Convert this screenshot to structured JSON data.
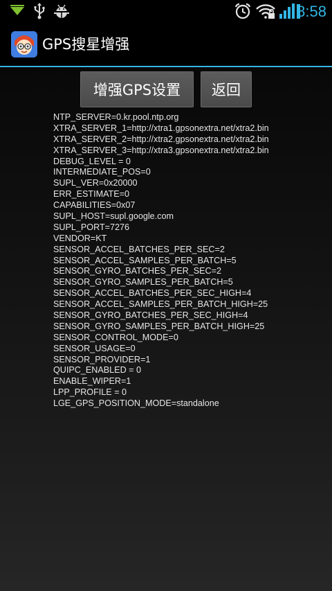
{
  "status_bar": {
    "time": "8:58",
    "icons": [
      "download-arrow-icon",
      "usb-icon",
      "android-bug-icon",
      "alarm-clock-icon",
      "wifi-locked-icon",
      "signal-bars-icon",
      "battery-icon"
    ],
    "time_color": "#33b5e5"
  },
  "title_bar": {
    "title": "GPS搜星增强",
    "icon": "app-icon",
    "divider_color": "#33b5e5"
  },
  "buttons": {
    "enhance_label": "增强GPS设置",
    "back_label": "返回"
  },
  "config_lines": [
    "NTP_SERVER=0.kr.pool.ntp.org",
    "XTRA_SERVER_1=http://xtra1.gpsonextra.net/xtra2.bin",
    "XTRA_SERVER_2=http://xtra2.gpsonextra.net/xtra2.bin",
    "XTRA_SERVER_3=http://xtra3.gpsonextra.net/xtra2.bin",
    "DEBUG_LEVEL = 0",
    "INTERMEDIATE_POS=0",
    "SUPL_VER=0x20000",
    "ERR_ESTIMATE=0",
    "CAPABILITIES=0x07",
    "SUPL_HOST=supl.google.com",
    "SUPL_PORT=7276",
    "VENDOR=KT",
    "SENSOR_ACCEL_BATCHES_PER_SEC=2",
    "SENSOR_ACCEL_SAMPLES_PER_BATCH=5",
    "SENSOR_GYRO_BATCHES_PER_SEC=2",
    "SENSOR_GYRO_SAMPLES_PER_BATCH=5",
    "SENSOR_ACCEL_BATCHES_PER_SEC_HIGH=4",
    "SENSOR_ACCEL_SAMPLES_PER_BATCH_HIGH=25",
    "SENSOR_GYRO_BATCHES_PER_SEC_HIGH=4",
    "SENSOR_GYRO_SAMPLES_PER_BATCH_HIGH=25",
    "SENSOR_CONTROL_MODE=0",
    "SENSOR_USAGE=0",
    "SENSOR_PROVIDER=1",
    "QUIPC_ENABLED = 0",
    "ENABLE_WIPER=1",
    "LPP_PROFILE = 0",
    "LGE_GPS_POSITION_MODE=standalone"
  ]
}
